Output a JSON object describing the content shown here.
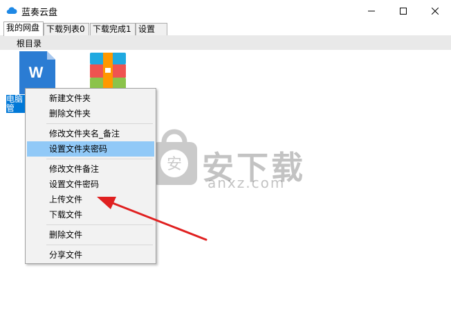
{
  "window": {
    "title": "蓝奏云盘",
    "accent": "#0078d7"
  },
  "tabs": [
    "我的网盘",
    "下载列表0",
    "下载完成1",
    "设置"
  ],
  "path": "根目录",
  "files": [
    {
      "type": "word-doc-icon",
      "label": "电脑\n管",
      "selected": true
    },
    {
      "type": "archive-icon",
      "label": ""
    }
  ],
  "context_menu": {
    "items": [
      "新建文件夹",
      "删除文件夹",
      "修改文件夹名_备注",
      "设置文件夹密码",
      "修改文件备注",
      "设置文件密码",
      "上传文件",
      "下载文件",
      "删除文件",
      "分享文件"
    ],
    "highlighted": "设置文件夹密码"
  },
  "watermark": {
    "text": "安下载",
    "sub": "anxz.com"
  }
}
